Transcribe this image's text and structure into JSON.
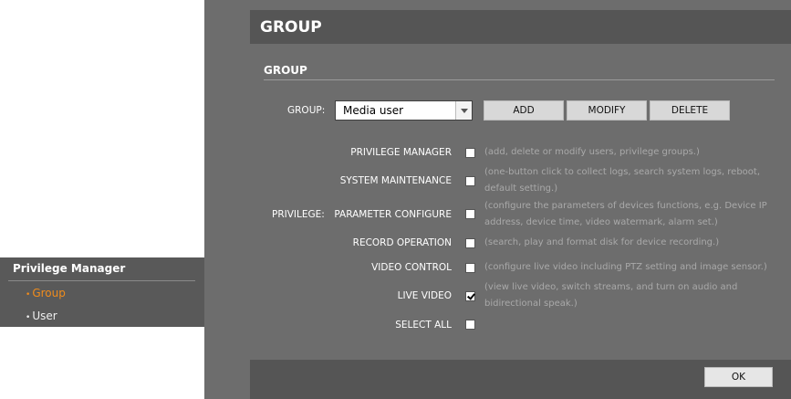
{
  "sidebar": {
    "title": "Privilege Manager",
    "items": [
      {
        "label": "Group",
        "active": true
      },
      {
        "label": "User",
        "active": false
      }
    ],
    "active_color": "#f08c1c"
  },
  "header": {
    "title": "GROUP"
  },
  "section": {
    "title": "GROUP"
  },
  "group": {
    "label": "GROUP:",
    "selected": "Media user"
  },
  "buttons": {
    "add": "ADD",
    "modify": "MODIFY",
    "delete": "DELETE",
    "ok": "OK"
  },
  "privilege": {
    "label": "PRIVILEGE:",
    "items": [
      {
        "name": "PRIVILEGE MANAGER",
        "checked": false,
        "desc": "(add, delete or modify users, privilege groups.)"
      },
      {
        "name": "SYSTEM MAINTENANCE",
        "checked": false,
        "desc": "(one-button click to collect logs, search system logs, reboot, default setting.)"
      },
      {
        "name": "PARAMETER CONFIGURE",
        "checked": false,
        "desc": "(configure the parameters of devices functions, e.g. Device IP address, device time, video watermark, alarm set.)"
      },
      {
        "name": "RECORD OPERATION",
        "checked": false,
        "desc": "(search, play and format disk for device recording.)"
      },
      {
        "name": "VIDEO CONTROL",
        "checked": false,
        "desc": "(configure live video including PTZ setting and image sensor.)"
      },
      {
        "name": "LIVE VIDEO",
        "checked": true,
        "desc": "(view live video, switch streams, and turn on audio and bidirectional speak.)"
      },
      {
        "name": "SELECT ALL",
        "checked": false,
        "desc": ""
      }
    ]
  }
}
